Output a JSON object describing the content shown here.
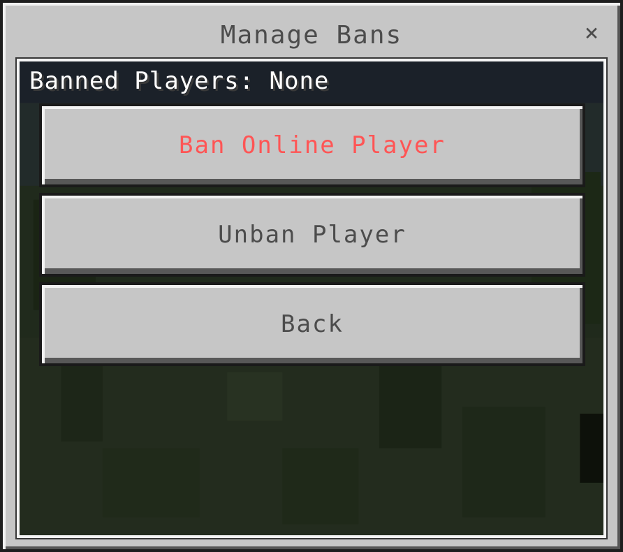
{
  "window": {
    "title": "Manage Bans",
    "close_glyph": "×"
  },
  "panel": {
    "banned_label": "Banned Players: None",
    "background_image": "dark-grass-landscape"
  },
  "buttons": {
    "ban_online": {
      "label": "Ban Online Player",
      "color": "#ff5555"
    },
    "unban": {
      "label": "Unban Player"
    },
    "back": {
      "label": "Back"
    }
  },
  "colors": {
    "window_bg": "#c6c6c6",
    "text_gray": "#4c4c4c",
    "accent_red": "#ff5555",
    "panel_dark": "#1c2230"
  }
}
